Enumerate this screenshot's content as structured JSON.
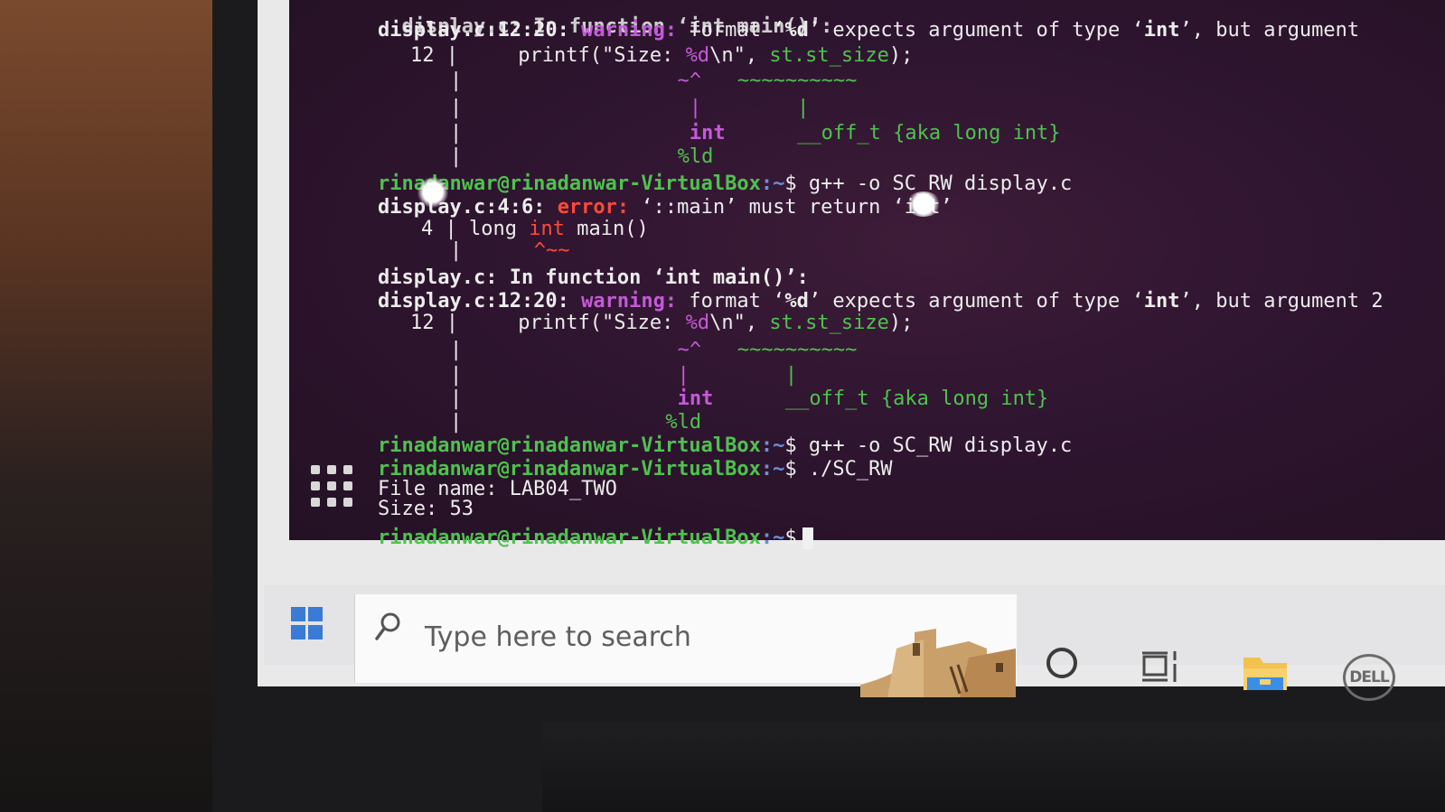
{
  "terminal": {
    "prompt_user": "rinadanwar@rinadanwar-VirtualBox",
    "prompt_path": ":~",
    "prompt_symbol": "$",
    "lines": {
      "l0": "display.c: In function ‘int main()’:",
      "l1_loc": "display.c:12:20:",
      "l1_tag": "warning:",
      "l1_msg_a": " format ‘",
      "l1_msg_b": "%d",
      "l1_msg_c": "’ expects argument of type ‘",
      "l1_msg_d": "int",
      "l1_msg_e": "’, but argument",
      "l2_num": "12",
      "l2_code_a": "printf(\"Size: ",
      "l2_code_b": "%d",
      "l2_code_c": "\\n\", ",
      "l2_code_d": "st.st_size",
      "l2_code_e": ");",
      "l3_carets": "~^",
      "l3_tildes": "~~~~~~~~~~",
      "l4_bar": "|",
      "l4_bar2": "|",
      "l5_int": "int",
      "l5_off": "__off_t {aka long int}",
      "l6_ld": "%ld",
      "cmd1": " g++ -o SC_RW display.c",
      "l8_loc": "display.c:4:6:",
      "l8_tag": "error:",
      "l8_msg": " ‘::main’ must return ‘int’",
      "l9_num": "4",
      "l9_code_a": "long ",
      "l9_code_b": "int",
      "l9_code_c": " main()",
      "l10_carets": "^~~",
      "l11": "display.c: In function ‘int main()’:",
      "l12_msg_e": "’, but argument 2",
      "cmd2": " g++ -o SC_RW display.c",
      "cmd3": " ./SC_RW",
      "out1": "File name: LAB04_TWO",
      "out2": "Size: 53"
    }
  },
  "taskbar": {
    "search_placeholder": "Type here to search",
    "dell_logo": "DELL",
    "icons": [
      "windows-start-icon",
      "search-icon",
      "cortana-icon",
      "task-view-icon",
      "file-explorer-icon"
    ]
  }
}
